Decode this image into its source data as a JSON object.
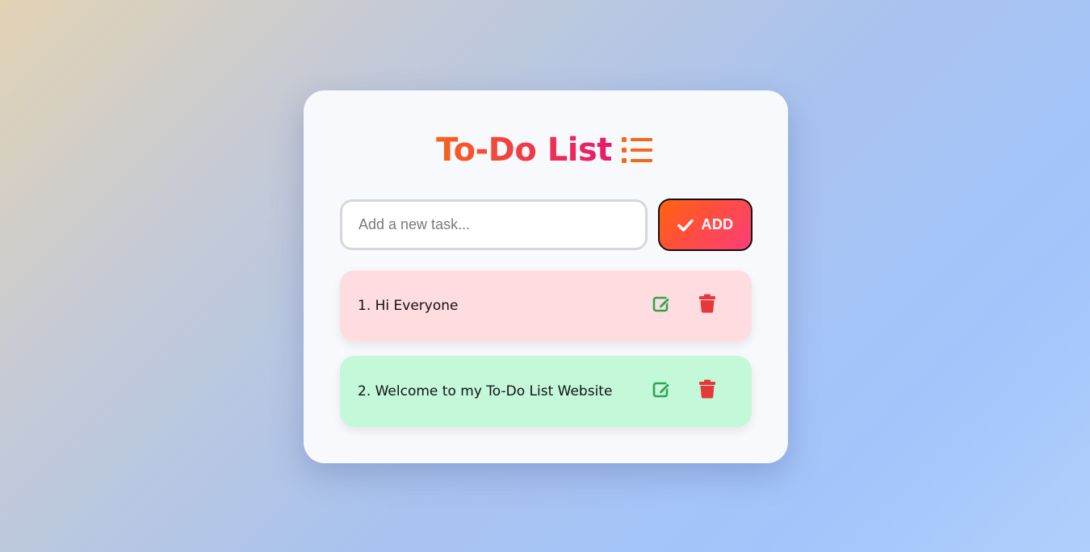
{
  "header": {
    "title": "To-Do List",
    "title_icon": "list-icon"
  },
  "composer": {
    "placeholder": "Add a new task...",
    "value": "",
    "add_label": "ADD",
    "add_icon": "check-icon"
  },
  "tasks": [
    {
      "text": "1. Hi Everyone",
      "color": "#ffdce0"
    },
    {
      "text": "2. Welcome to my To-Do List Website",
      "color": "#c3f8d9"
    }
  ],
  "icons": {
    "edit": "edit-icon",
    "delete": "trash-icon"
  },
  "colors": {
    "accent_orange": "#f7641b",
    "accent_pink": "#e8196c",
    "edit_green": "#28a745",
    "delete_red": "#e63946"
  }
}
